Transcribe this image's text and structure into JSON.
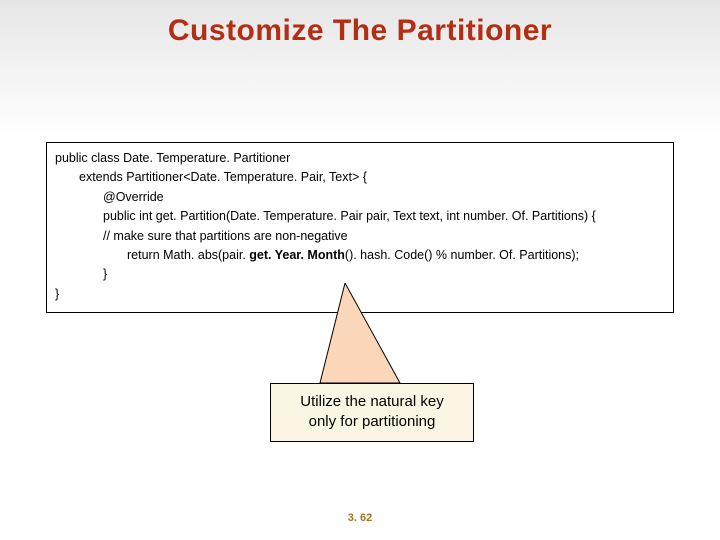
{
  "title": "Customize The Partitioner",
  "code": {
    "line1": "public class Date. Temperature. Partitioner",
    "line2": "extends Partitioner<Date. Temperature. Pair, Text> {",
    "line3": "@Override",
    "line4": "public int get. Partition(Date. Temperature. Pair pair, Text text, int number. Of. Partitions) {",
    "line5": "// make sure that partitions are non-negative",
    "line6a": "return Math. abs(pair. ",
    "line6b": "get. Year. Month",
    "line6c": "(). hash. Code() % number. Of. Partitions);",
    "line7": "}",
    "line8": "}"
  },
  "callout": {
    "line1": "Utilize the natural key",
    "line2": "only for partitioning"
  },
  "pagenum": "3. 62"
}
